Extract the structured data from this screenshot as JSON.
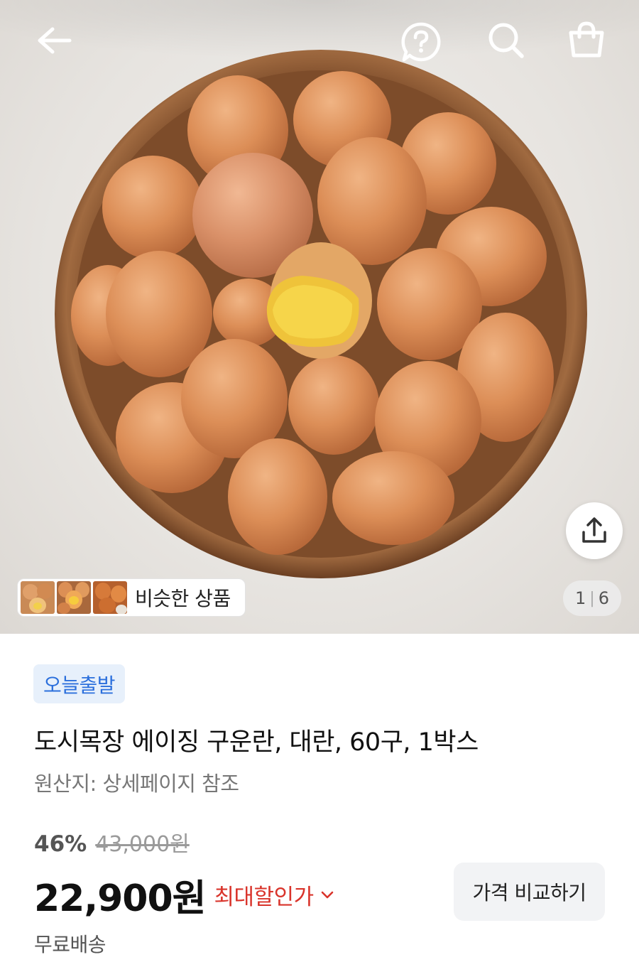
{
  "header": {
    "icons": [
      "back-arrow-icon",
      "help-icon",
      "search-icon",
      "cart-icon"
    ]
  },
  "gallery": {
    "current_index": "1",
    "total": "6",
    "similar_label": "비슷한 상품",
    "share_icon": "share-icon"
  },
  "product": {
    "badge": "오늘출발",
    "title": "도시목장 에이징 구운란, 대란, 60구, 1박스",
    "origin": "원산지: 상세페이지 참조",
    "discount_rate": "46%",
    "original_price": "43,000원",
    "price": "22,900원",
    "max_discount_label": "최대할인가",
    "compare_button": "가격 비교하기",
    "shipping": "무료배송"
  },
  "colors": {
    "badge_bg": "#e7f0fb",
    "badge_text": "#2b6fdc",
    "discount_red": "#d9342b",
    "plate": "#8a5a35",
    "egg": "#d98a54"
  }
}
